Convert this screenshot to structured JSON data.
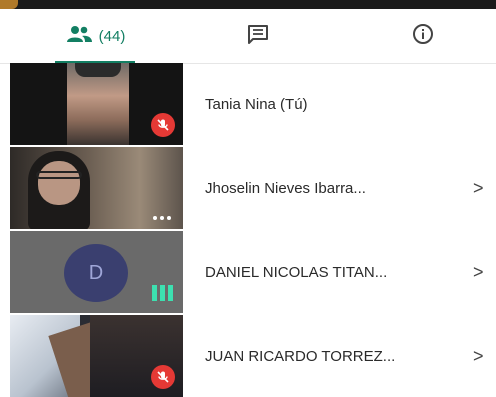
{
  "tabs": {
    "people": {
      "icon": "people-icon",
      "count": "(44)"
    },
    "chat": {
      "icon": "chat-icon"
    },
    "info": {
      "icon": "info-icon"
    }
  },
  "participants": [
    {
      "name": "Tania Nina (Tú)",
      "status": "muted"
    },
    {
      "name": "Jhoselin Nieves Ibarra...",
      "status": "more",
      "chevron": ">"
    },
    {
      "name": "DANIEL NICOLAS TITAN...",
      "status": "speaking",
      "avatar_letter": "D",
      "chevron": ">"
    },
    {
      "name": "JUAN RICARDO TORREZ...",
      "status": "muted",
      "chevron": ">"
    }
  ],
  "colors": {
    "accent": "#137f63",
    "muted_badge": "#e53935",
    "speaking_bars": "#3de0b0",
    "avatar_bg": "#3a3f6f"
  }
}
